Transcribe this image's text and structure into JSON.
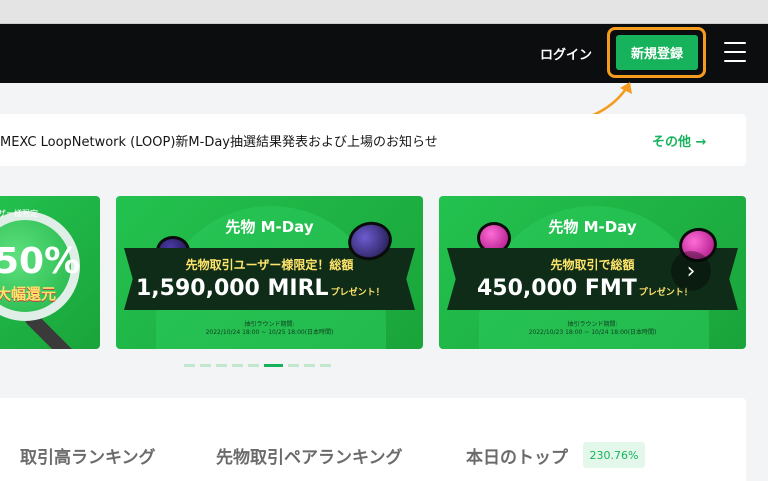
{
  "header": {
    "login_label": "ログイン",
    "signup_label": "新規登録",
    "menu_icon": "hamburger-menu-icon"
  },
  "notice": {
    "text": "MEXC LoopNetwork (LOOP)新M-Day抽選結果発表および上場のお知らせ",
    "more_label": "その他 →"
  },
  "banners": [
    {
      "top_text": "ザー様限定",
      "big_text": "50%",
      "sub_text": "大幅還元"
    },
    {
      "title": "先物 M-Day",
      "line1": "先物取引ユーザー様限定！総額",
      "amount": "1,590,000 MIRL",
      "amount_suffix": "プレゼント！",
      "period_label": "抽引ラウンド期間:",
      "period": "2022/10/24 18:00 ~ 10/25 18:00(日本時間)"
    },
    {
      "title": "先物 M-Day",
      "line1": "先物取引で総額",
      "amount": "450,000 FMT",
      "amount_suffix": "プレゼント！",
      "period_label": "抽引ラウンド期間:",
      "period": "2022/10/23 18:00 ~ 10/24 18:00(日本時間)"
    }
  ],
  "carousel": {
    "next_icon": "chevron-right-icon",
    "dot_count": 9,
    "active_index": 5
  },
  "ranking": {
    "tabs": [
      "取引高ランキング",
      "先物取引ペアランキング",
      "本日のトップ"
    ],
    "top_badge": "230.76%"
  },
  "colors": {
    "brand_green": "#17b35c",
    "highlight_orange": "#f59c1e",
    "header_bg": "#0c0d0f"
  }
}
